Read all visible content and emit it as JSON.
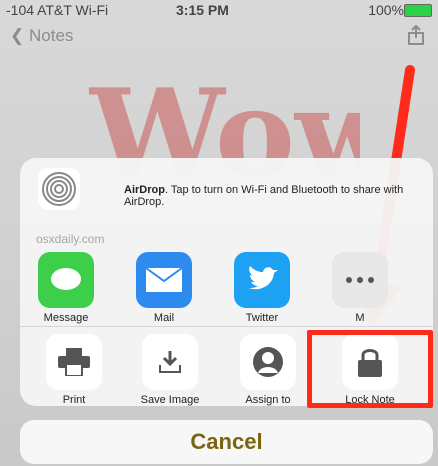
{
  "status": {
    "left": "-104 AT&T Wi-Fi",
    "time": "3:15 PM",
    "right": "100%"
  },
  "nav": {
    "back_label": "Notes"
  },
  "sketch": {
    "text": "Wow"
  },
  "share_sheet": {
    "airdrop_title": "AirDrop",
    "airdrop_desc": ". Tap to turn on Wi-Fi and Bluetooth to share with AirDrop.",
    "source": "osxdaily.com",
    "apps": [
      {
        "label": "Message",
        "color": "#3ecf4a"
      },
      {
        "label": "Mail",
        "color": "#2d8bf0"
      },
      {
        "label": "Twitter",
        "color": "#1da1f2"
      },
      {
        "label": "M",
        "color": "#e8e8e8"
      }
    ],
    "actions": [
      {
        "label": "Print"
      },
      {
        "label": "Save Image"
      },
      {
        "label": "Assign to Contact"
      },
      {
        "label": "Lock Note"
      }
    ]
  },
  "cancel_label": "Cancel"
}
